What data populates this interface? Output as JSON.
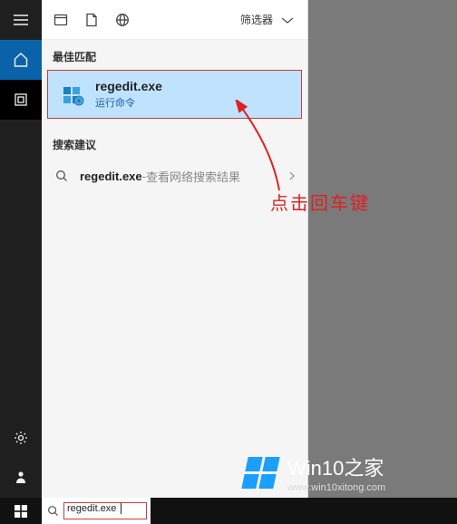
{
  "header": {
    "filter_label": "筛选器"
  },
  "sections": {
    "best_match_label": "最佳匹配",
    "suggest_label": "搜索建议"
  },
  "best_match": {
    "title": "regedit.exe",
    "subtitle": "运行命令"
  },
  "suggestion": {
    "query": "regedit.exe",
    "separator": " - ",
    "desc": "查看网络搜索结果"
  },
  "search_input": {
    "value": "regedit.exe"
  },
  "annotation": {
    "text": "点击回车键"
  },
  "watermark": {
    "title": "Win10之家",
    "url": "www.win10xitong.com"
  }
}
